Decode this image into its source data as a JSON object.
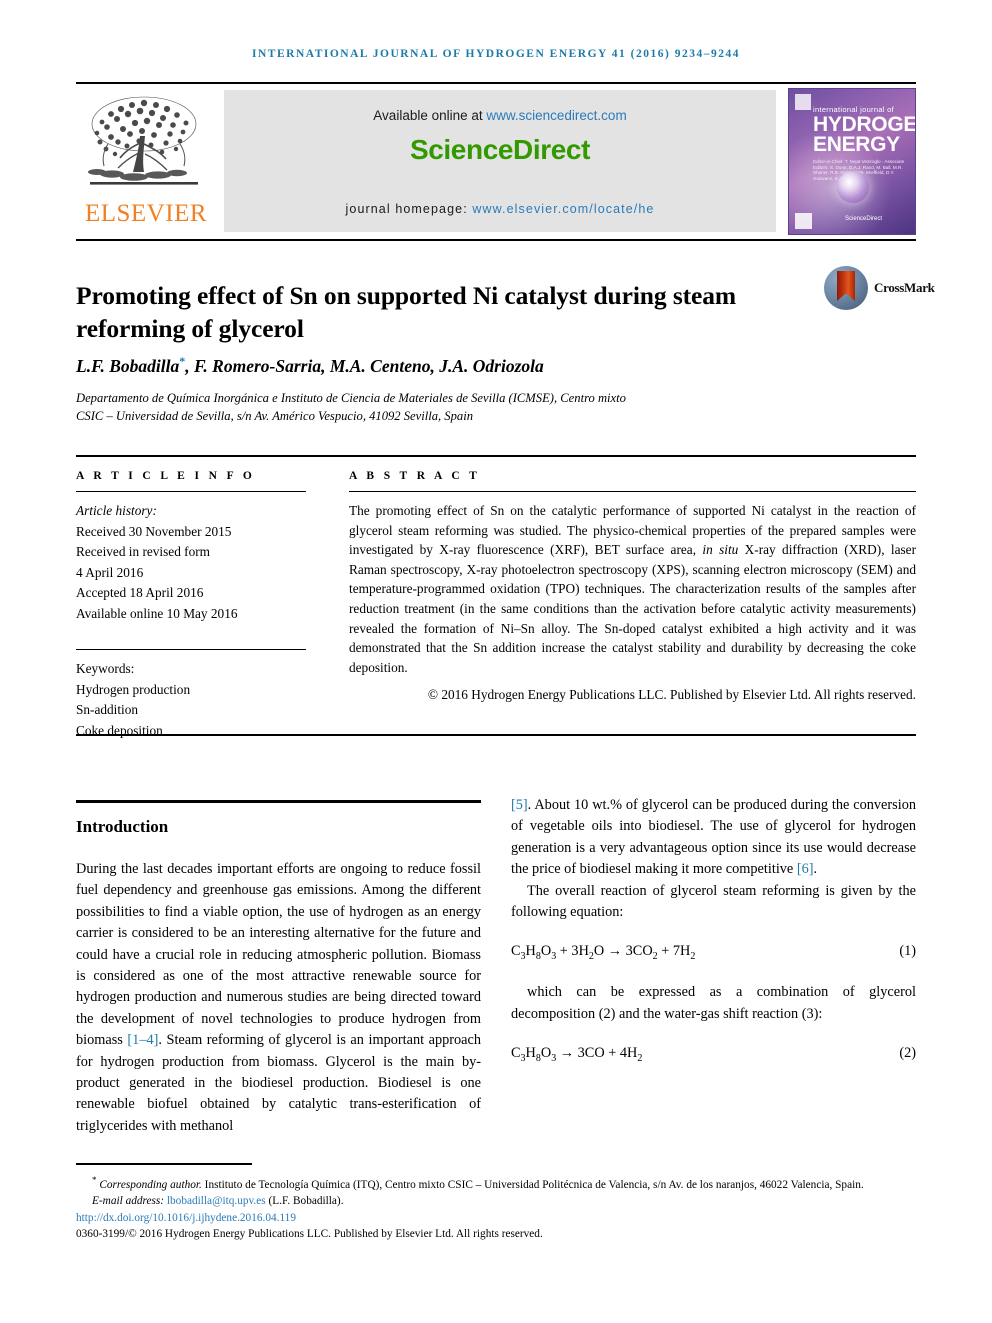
{
  "running_head": "INTERNATIONAL JOURNAL OF HYDROGEN ENERGY 41 (2016) 9234–9244",
  "masthead": {
    "publisher_name": "ELSEVIER",
    "available_prefix": "Available online at ",
    "available_url": "www.sciencedirect.com",
    "sciencedirect_logo": "ScienceDirect",
    "homepage_prefix": "journal homepage: ",
    "homepage_url": "www.elsevier.com/locate/he",
    "cover": {
      "kicker": "international journal of",
      "title_line1": "HYDROGEN",
      "title_line2": "ENERGY",
      "editors": "Editor-in-Chief: T. Nejat Veziroglu · Associate Editors: S. Dunn, D.A.J. Rand, M. Ball, M.R. Shaner, R.B. Gupta, J.W. Sheffield, D.Y. Goswami, S.A. Sherif",
      "sciencedirect_mark": "ScienceDirect"
    }
  },
  "article": {
    "title": "Promoting effect of Sn on supported Ni catalyst during steam reforming of glycerol",
    "crossmark_label": "CrossMark",
    "authors": "L.F. Bobadilla*, F. Romero-Sarria, M.A. Centeno, J.A. Odriozola",
    "authors_plain": "L.F. Bobadilla, F. Romero-Sarria, M.A. Centeno, J.A. Odriozola",
    "affiliation_line1": "Departamento de Química Inorgánica e Instituto de Ciencia de Materiales de Sevilla (ICMSE), Centro mixto",
    "affiliation_line2": "CSIC – Universidad de Sevilla, s/n Av. Américo Vespucio, 41092 Sevilla, Spain"
  },
  "article_info": {
    "heading": "A R T I C L E  I N F O",
    "history_label": "Article history:",
    "history": [
      "Received 30 November 2015",
      "Received in revised form",
      "4 April 2016",
      "Accepted 18 April 2016",
      "Available online 10 May 2016"
    ],
    "keywords_label": "Keywords:",
    "keywords": [
      "Hydrogen production",
      "Sn-addition",
      "Coke deposition"
    ]
  },
  "abstract": {
    "heading": "A B S T R A C T",
    "text_part1": "The promoting effect of Sn on the catalytic performance of supported Ni catalyst in the reaction of glycerol steam reforming was studied. The physico-chemical properties of the prepared samples were investigated by X-ray fluorescence (XRF), BET surface area, ",
    "in_situ": "in situ",
    "text_part2": " X-ray diffraction (XRD), laser Raman spectroscopy, X-ray photoelectron spectroscopy (XPS), scanning electron microscopy (SEM) and temperature-programmed oxidation (TPO) techniques. The characterization results of the samples after reduction treatment (in the same conditions than the activation before catalytic activity measurements) revealed the formation of Ni–Sn alloy. The Sn-doped catalyst exhibited a high activity and it was demonstrated that the Sn addition increase the catalyst stability and durability by decreasing the coke deposition.",
    "copyright": "© 2016 Hydrogen Energy Publications LLC. Published by Elsevier Ltd. All rights reserved."
  },
  "body": {
    "section_title": "Introduction",
    "left_para1_a": "During the last decades important efforts are ongoing to reduce fossil fuel dependency and greenhouse gas emissions. Among the different possibilities to find a viable option, the use of hydrogen as an energy carrier is considered to be an interesting alternative for the future and could have a crucial role in reducing atmospheric pollution. Biomass is considered as one of the most attractive renewable source for hydrogen production and numerous studies are being directed toward the development of novel technologies to produce hydrogen from biomass ",
    "left_ref_1_4": "[1–4]",
    "left_para1_b": ". Steam reforming of glycerol is an important approach for hydrogen production from biomass. Glycerol is the main by-product generated in the biodiesel production. Biodiesel is one renewable biofuel obtained by catalytic trans-esterification of triglycerides with methanol",
    "right_ref_5": "[5]",
    "right_para1_a": ". About 10 wt.% of glycerol can be produced during the conversion of vegetable oils into biodiesel. The use of glycerol for hydrogen generation is a very advantageous option since its use would decrease the price of biodiesel making it more competitive ",
    "right_ref_6": "[6]",
    "right_para1_b": ".",
    "right_para2": "The overall reaction of glycerol steam reforming is given by the following equation:",
    "equation1": "C3H8O3 + 3H2O → 3CO2 + 7H2",
    "equation1_number": "(1)",
    "right_para3": "which can be expressed as a combination of glycerol decomposition (2) and the water-gas shift reaction (3):",
    "equation2": "C3H8O3 → 3CO + 4H2",
    "equation2_number": "(2)"
  },
  "footer": {
    "corresponding_marker": "*",
    "corresponding_label": "Corresponding author.",
    "corresponding_text": " Instituto de Tecnología Química (ITQ), Centro mixto CSIC – Universidad Politécnica de Valencia, s/n Av. de los naranjos, 46022 Valencia, Spain.",
    "email_label": "E-mail address: ",
    "email": "lbobadilla@itq.upv.es",
    "email_owner": " (L.F. Bobadilla).",
    "doi": "http://dx.doi.org/10.1016/j.ijhydene.2016.04.119",
    "issn_copyright": "0360-3199/© 2016 Hydrogen Energy Publications LLC. Published by Elsevier Ltd. All rights reserved."
  },
  "colors": {
    "link_blue": "#2b7bb9",
    "running_head_blue": "#1c7aa8",
    "elsevier_orange": "#f08023",
    "sciencedirect_green": "#339900",
    "reference_blue": "#1c7aa8"
  }
}
